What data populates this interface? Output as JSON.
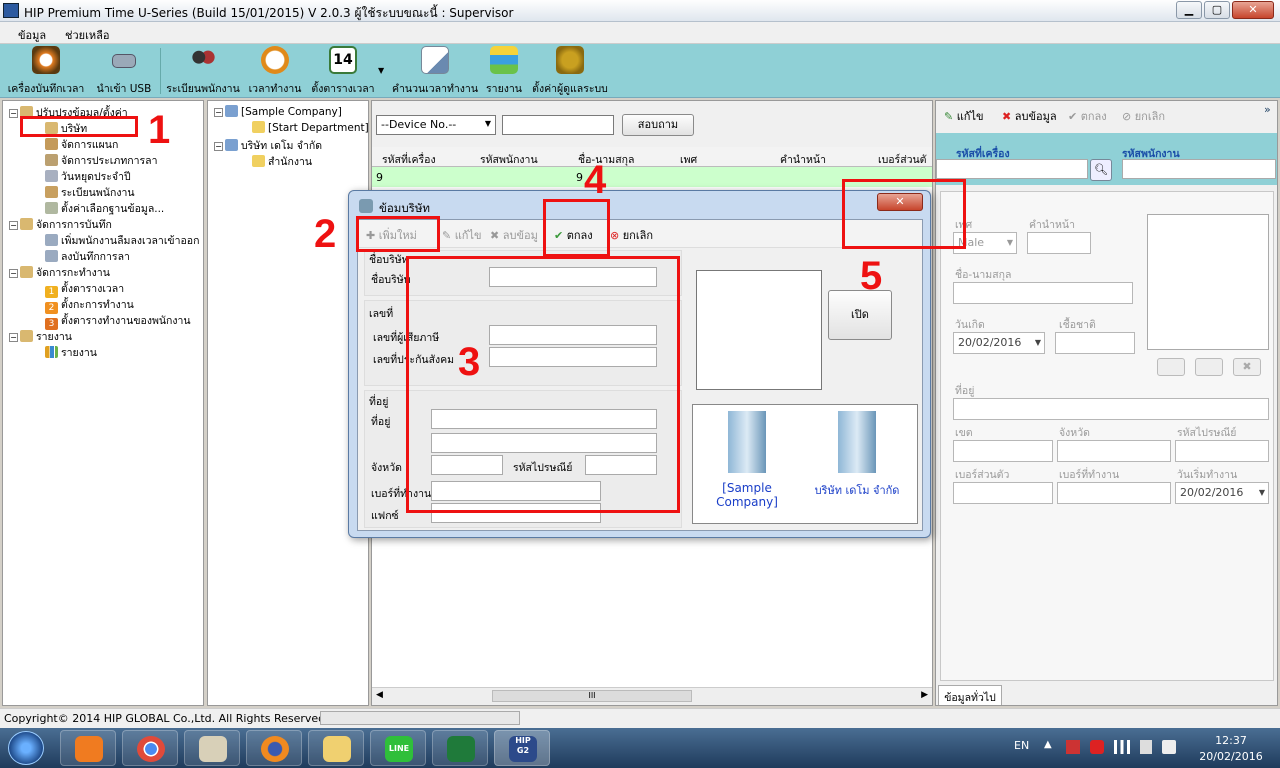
{
  "window": {
    "title": "HIP Premium Time U-Series (Build 15/01/2015) V 2.0.3    ผู้ใช้ระบบขณะนี้  : Supervisor",
    "minimize": "▁",
    "maximize": "▢",
    "close": "✕"
  },
  "menu": {
    "items": [
      "ข้อมูล",
      "ช่วยเหลือ"
    ]
  },
  "toolbar": {
    "items": [
      "เครื่องบันทึกเวลา",
      "นำเข้า USB",
      "ระเบียนพนักงาน",
      "เวลาทำงาน",
      "ตั้งตารางเวลา",
      "คำนวนเวลาทำงาน",
      "รายงาน",
      "ตั้งค่าผู้ดูแลระบบ"
    ],
    "calendar_day": "14",
    "icons": [
      "alarm-clock-icon",
      "usb-icon",
      "employees-icon",
      "clock-icon",
      "calendar-icon",
      "calculate-icon",
      "report-icon",
      "admin-icon"
    ]
  },
  "left_tree": {
    "items": [
      "ปรับปรุงข้อมูล/ตั้งค่า",
      "บริษัท",
      "จัดการแผนก",
      "จัดการประเภทการลา",
      "วันหยุดประจำปี",
      "ระเบียนพนักงาน",
      "ตั้งค่าเลือกฐานข้อมูล...",
      "จัดการการบันทึก",
      "เพิ่มพนักงานลืมลงเวลาเข้าออก",
      "ลงบันทึกการลา",
      "จัดการกะทำงาน",
      "ตั้งตารางเวลา",
      "ตั้งกะการทำงาน",
      "ตั้งตารางทำงานของพนักงาน",
      "รายงาน",
      "รายงาน"
    ],
    "step_numbers": [
      "1",
      "2",
      "3"
    ]
  },
  "mid_tree": {
    "items": [
      "[Sample Company]",
      "[Start Department]",
      "บริษัท เดโม จำกัด",
      "สำนักงาน"
    ]
  },
  "center": {
    "device_select": "--Device No.--",
    "search_button": "สอบถาม",
    "columns": [
      "รหัสที่เครื่อง",
      "รหัสพนักงาน",
      "ชื่อ-นามสกุล",
      "เพศ",
      "คำนำหน้า",
      "เบอร์ส่วนตั"
    ],
    "rows": [
      [
        "9",
        "",
        "9",
        "",
        "",
        ""
      ]
    ],
    "scroll_grip": "III"
  },
  "right": {
    "toolbar": {
      "edit": "แก้ไข",
      "delete": "ลบข้อมูล",
      "ok": "ตกลง",
      "cancel": "ยกเลิก"
    },
    "expand": "»",
    "device_id_label": "รหัสที่เครื่อง",
    "employee_id_label": "รหัสพนักงาน",
    "gender_label": "เพศ",
    "gender_value": "Male",
    "prefix_label": "คำนำหน้า",
    "fullname_label": "ชื่อ-นามสกุล",
    "birthday_label": "วันเกิด",
    "birthday_value": "20/02/2016",
    "nationality_label": "เชื้อชาติ",
    "address_label": "ที่อยู่",
    "district_label": "เขต",
    "province_label": "จังหวัด",
    "postcode_label": "รหัสไปรษณีย์",
    "personal_phone_label": "เบอร์ส่วนตัว",
    "work_phone_label": "เบอร์ที่ทำงาน",
    "start_date_label": "วันเริ่มทำงาน",
    "start_date_value": "20/02/2016",
    "tab": "ข้อมูลทั่วไป"
  },
  "dialog": {
    "title": "ข้อมบริษัท",
    "toolbar": {
      "add": "เพิ่มใหม่",
      "edit": "แก้ไข",
      "delete": "ลบข้อมู",
      "ok": "ตกลง",
      "cancel": "ยกเลิก"
    },
    "group_company": "ชื่อบริษัท",
    "company_name_label": "ชื่อบริษัท",
    "group_number": "เลขที่",
    "tax_id_label": "เลขที่ผู้เสียภาษี",
    "social_security_label": "เลขที่ประกันสังคม",
    "group_address": "ที่อยู่",
    "address_label": "ที่อยู่",
    "province_label": "จังหวัด",
    "postcode_label": "รหัสไปรษณีย์",
    "phone_label": "เบอร์ที่ทำงาน",
    "fax_label": "แฟกซ์",
    "open_button": "เปิด",
    "companies": [
      "[Sample Company]",
      "บริษัท เดโม จำกัด"
    ],
    "close": "✕"
  },
  "annotations": [
    "1",
    "2",
    "3",
    "4",
    "5"
  ],
  "status": {
    "copyright": "Copyright© 2014 HIP GLOBAL Co.,Ltd. All Rights Reserved"
  },
  "taskbar": {
    "apps": [
      "media-player-icon",
      "chrome-icon",
      "paint-icon",
      "firefox-icon",
      "explorer-icon",
      "line-icon",
      "excel-icon",
      "hip-time-icon"
    ],
    "line_label": "LINE",
    "hip_label": "HIP",
    "hip_sub": "G2",
    "lang": "EN",
    "time": "12:37",
    "date": "20/02/2016"
  },
  "colors": {
    "toolbar_bg": "#8fd0d6",
    "grid_row": "#ccffcc",
    "annotation": "#ee1111",
    "label_blue": "#1a4ea8"
  }
}
